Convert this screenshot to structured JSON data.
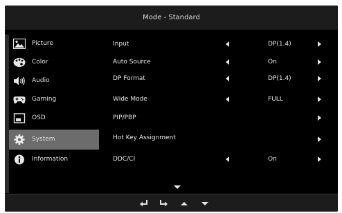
{
  "header": {
    "title": "Mode - Standard"
  },
  "sidebar": {
    "items": [
      {
        "label": "Picture",
        "icon": "picture-icon"
      },
      {
        "label": "Color",
        "icon": "palette-icon"
      },
      {
        "label": "Audio",
        "icon": "speaker-icon"
      },
      {
        "label": "Gaming",
        "icon": "gamepad-icon"
      },
      {
        "label": "OSD",
        "icon": "osd-icon"
      },
      {
        "label": "System",
        "icon": "gear-icon",
        "selected": true
      },
      {
        "label": "Information",
        "icon": "info-icon"
      }
    ]
  },
  "settings": {
    "rows": [
      {
        "label": "Input",
        "value": "DP(1.4)"
      },
      {
        "label": "Auto Source",
        "value": "On"
      },
      {
        "label": "DP Format",
        "value": "DP(1.4)"
      },
      {
        "label": "Wide Mode",
        "value": "FULL"
      },
      {
        "label": "PIP/PBP",
        "value": ""
      },
      {
        "label": "Hot Key Assignment",
        "value": ""
      },
      {
        "label": "DDC/CI",
        "value": "On"
      }
    ]
  },
  "footer": {
    "buttons": [
      "back-icon",
      "enter-icon",
      "up-arrow-icon",
      "down-arrow-icon"
    ]
  },
  "colors": {
    "background": "#000000",
    "selected": "#6c6c6c",
    "text": "#e6e6e6",
    "header": "#1c1c1c"
  }
}
